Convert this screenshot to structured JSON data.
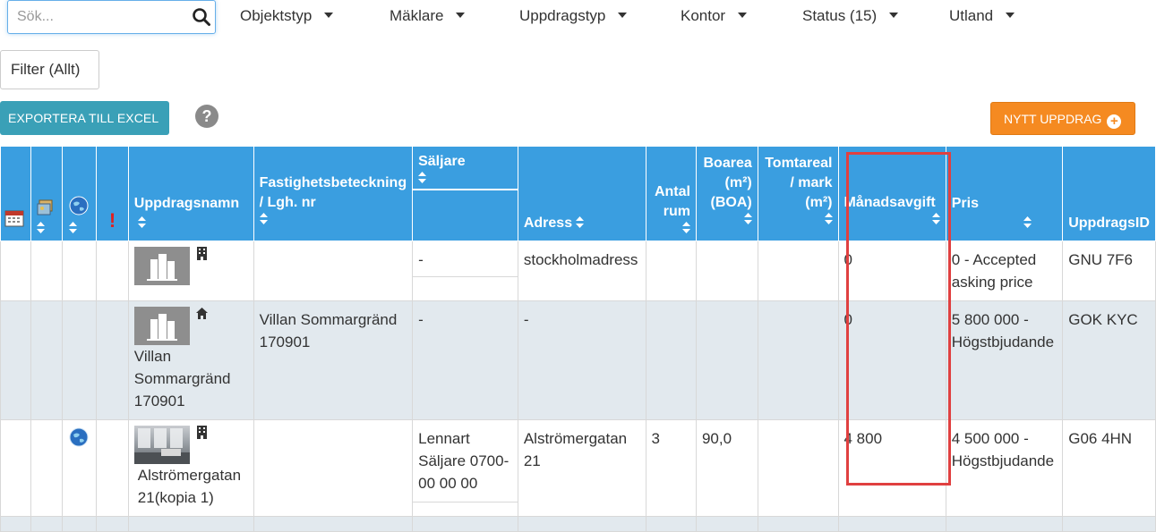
{
  "search": {
    "placeholder": "Sök..."
  },
  "filters": [
    {
      "label": "Objektstyp"
    },
    {
      "label": "Mäklare"
    },
    {
      "label": "Uppdragstyp"
    },
    {
      "label": "Kontor"
    },
    {
      "label": "Status (15)"
    },
    {
      "label": "Utland"
    }
  ],
  "filter_button": "Filter (Allt)",
  "export_button": "EXPORTERA TILL EXCEL",
  "new_button": "NYTT UPPDRAG",
  "icons": [
    "search-icon",
    "chevron-down-icon",
    "help-icon",
    "plus-circle-icon",
    "calendar-icon",
    "photo-icon",
    "globe-icon",
    "exclamation-icon",
    "sort-icon",
    "building-icon",
    "house-icon"
  ],
  "colors": {
    "header_bg": "#3a9ee0",
    "export_bg": "#3aa0b7",
    "new_bg": "#f58a21",
    "alt_row": "#e2e9ee",
    "highlight": "#e04040",
    "exclamation": "#e02020"
  },
  "table": {
    "headers": {
      "name": "Uppdragsnamn",
      "property": "Fastighetsbeteckning / Lgh. nr",
      "seller": "Säljare",
      "address": "Adress",
      "rooms": "Antal rum",
      "living_area": "Boarea (m²) (BOA)",
      "plot_area": "Tomtareal / mark (m²)",
      "monthly_fee": "Månadsavgift",
      "price": "Pris",
      "id": "UppdragsID"
    },
    "rows": [
      {
        "name": "",
        "property": "",
        "seller": "-",
        "address": "stockholmadress",
        "rooms": "",
        "living_area": "",
        "plot_area": "",
        "monthly_fee": "0",
        "price": "0  -  Accepted asking price",
        "id": "GNU 7F6"
      },
      {
        "name": "Villan Sommargränd 170901",
        "property": "Villan Sommargränd 170901",
        "seller": "-",
        "address": "-",
        "rooms": "",
        "living_area": "",
        "plot_area": "",
        "monthly_fee": "0",
        "price": "5 800 000  -  Högstbjudande",
        "id": "GOK KYC"
      },
      {
        "name": "Alströmergatan 21(kopia 1)",
        "property": "",
        "seller": "Lennart Säljare 0700-00 00 00",
        "address": "Alströmergatan 21",
        "rooms": "3",
        "living_area": "90,0",
        "plot_area": "",
        "monthly_fee": "4 800",
        "price": "4 500 000  -  Högstbjudande",
        "id": "G06 4HN"
      }
    ]
  }
}
